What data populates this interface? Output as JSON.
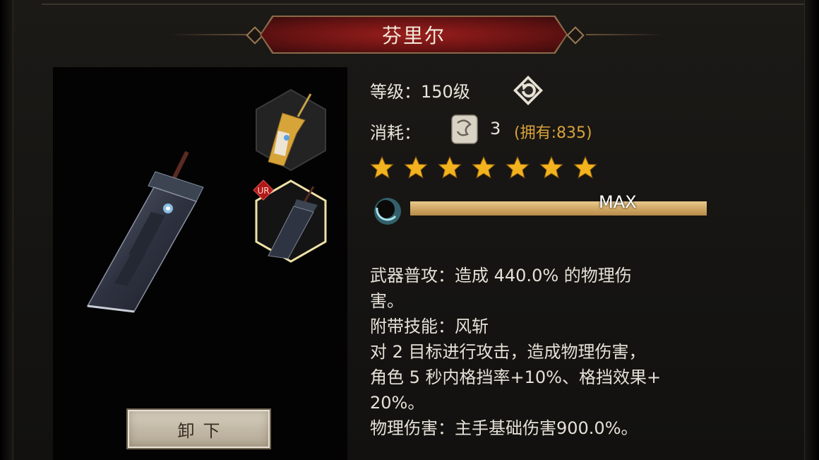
{
  "title": "芬里尔",
  "level": {
    "label": "等级：",
    "value": "150级"
  },
  "cost": {
    "label": "消耗：",
    "amount": "3",
    "owned": "(拥有:835)"
  },
  "stars": {
    "count": 7,
    "color": "#f2b31e"
  },
  "exp": {
    "label": "MAX",
    "fill_fraction": 1.0
  },
  "slots": [
    {
      "name": "gold-sword-slot",
      "selected": false
    },
    {
      "name": "buster-sword-slot",
      "selected": true,
      "rarity": "UR"
    }
  ],
  "description": {
    "line1": "武器普攻：造成 440.0% 的物理伤",
    "line2": "害。",
    "line3": "附带技能：风斩",
    "line4": "对 2 目标进行攻击，造成物理伤害，",
    "line5": "角色 5 秒内格挡率+10%、格挡效果+",
    "line6": "20%。",
    "line7": "物理伤害：主手基础伤害900.0%。"
  },
  "buttons": {
    "unequip": "卸下"
  },
  "colors": {
    "accent_gold": "#d9a23a",
    "banner_red": "#8a1c1a",
    "hex_selected": "#efe2a8"
  }
}
